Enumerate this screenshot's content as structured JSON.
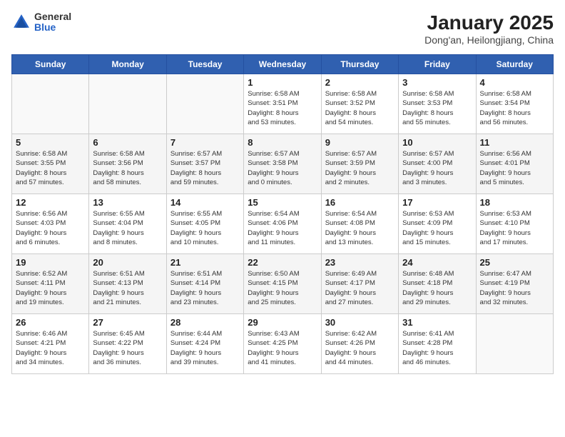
{
  "header": {
    "logo_general": "General",
    "logo_blue": "Blue",
    "title": "January 2025",
    "subtitle": "Dong'an, Heilongjiang, China"
  },
  "days_of_week": [
    "Sunday",
    "Monday",
    "Tuesday",
    "Wednesday",
    "Thursday",
    "Friday",
    "Saturday"
  ],
  "weeks": [
    [
      {
        "day": "",
        "info": ""
      },
      {
        "day": "",
        "info": ""
      },
      {
        "day": "",
        "info": ""
      },
      {
        "day": "1",
        "info": "Sunrise: 6:58 AM\nSunset: 3:51 PM\nDaylight: 8 hours\nand 53 minutes."
      },
      {
        "day": "2",
        "info": "Sunrise: 6:58 AM\nSunset: 3:52 PM\nDaylight: 8 hours\nand 54 minutes."
      },
      {
        "day": "3",
        "info": "Sunrise: 6:58 AM\nSunset: 3:53 PM\nDaylight: 8 hours\nand 55 minutes."
      },
      {
        "day": "4",
        "info": "Sunrise: 6:58 AM\nSunset: 3:54 PM\nDaylight: 8 hours\nand 56 minutes."
      }
    ],
    [
      {
        "day": "5",
        "info": "Sunrise: 6:58 AM\nSunset: 3:55 PM\nDaylight: 8 hours\nand 57 minutes."
      },
      {
        "day": "6",
        "info": "Sunrise: 6:58 AM\nSunset: 3:56 PM\nDaylight: 8 hours\nand 58 minutes."
      },
      {
        "day": "7",
        "info": "Sunrise: 6:57 AM\nSunset: 3:57 PM\nDaylight: 8 hours\nand 59 minutes."
      },
      {
        "day": "8",
        "info": "Sunrise: 6:57 AM\nSunset: 3:58 PM\nDaylight: 9 hours\nand 0 minutes."
      },
      {
        "day": "9",
        "info": "Sunrise: 6:57 AM\nSunset: 3:59 PM\nDaylight: 9 hours\nand 2 minutes."
      },
      {
        "day": "10",
        "info": "Sunrise: 6:57 AM\nSunset: 4:00 PM\nDaylight: 9 hours\nand 3 minutes."
      },
      {
        "day": "11",
        "info": "Sunrise: 6:56 AM\nSunset: 4:01 PM\nDaylight: 9 hours\nand 5 minutes."
      }
    ],
    [
      {
        "day": "12",
        "info": "Sunrise: 6:56 AM\nSunset: 4:03 PM\nDaylight: 9 hours\nand 6 minutes."
      },
      {
        "day": "13",
        "info": "Sunrise: 6:55 AM\nSunset: 4:04 PM\nDaylight: 9 hours\nand 8 minutes."
      },
      {
        "day": "14",
        "info": "Sunrise: 6:55 AM\nSunset: 4:05 PM\nDaylight: 9 hours\nand 10 minutes."
      },
      {
        "day": "15",
        "info": "Sunrise: 6:54 AM\nSunset: 4:06 PM\nDaylight: 9 hours\nand 11 minutes."
      },
      {
        "day": "16",
        "info": "Sunrise: 6:54 AM\nSunset: 4:08 PM\nDaylight: 9 hours\nand 13 minutes."
      },
      {
        "day": "17",
        "info": "Sunrise: 6:53 AM\nSunset: 4:09 PM\nDaylight: 9 hours\nand 15 minutes."
      },
      {
        "day": "18",
        "info": "Sunrise: 6:53 AM\nSunset: 4:10 PM\nDaylight: 9 hours\nand 17 minutes."
      }
    ],
    [
      {
        "day": "19",
        "info": "Sunrise: 6:52 AM\nSunset: 4:11 PM\nDaylight: 9 hours\nand 19 minutes."
      },
      {
        "day": "20",
        "info": "Sunrise: 6:51 AM\nSunset: 4:13 PM\nDaylight: 9 hours\nand 21 minutes."
      },
      {
        "day": "21",
        "info": "Sunrise: 6:51 AM\nSunset: 4:14 PM\nDaylight: 9 hours\nand 23 minutes."
      },
      {
        "day": "22",
        "info": "Sunrise: 6:50 AM\nSunset: 4:15 PM\nDaylight: 9 hours\nand 25 minutes."
      },
      {
        "day": "23",
        "info": "Sunrise: 6:49 AM\nSunset: 4:17 PM\nDaylight: 9 hours\nand 27 minutes."
      },
      {
        "day": "24",
        "info": "Sunrise: 6:48 AM\nSunset: 4:18 PM\nDaylight: 9 hours\nand 29 minutes."
      },
      {
        "day": "25",
        "info": "Sunrise: 6:47 AM\nSunset: 4:19 PM\nDaylight: 9 hours\nand 32 minutes."
      }
    ],
    [
      {
        "day": "26",
        "info": "Sunrise: 6:46 AM\nSunset: 4:21 PM\nDaylight: 9 hours\nand 34 minutes."
      },
      {
        "day": "27",
        "info": "Sunrise: 6:45 AM\nSunset: 4:22 PM\nDaylight: 9 hours\nand 36 minutes."
      },
      {
        "day": "28",
        "info": "Sunrise: 6:44 AM\nSunset: 4:24 PM\nDaylight: 9 hours\nand 39 minutes."
      },
      {
        "day": "29",
        "info": "Sunrise: 6:43 AM\nSunset: 4:25 PM\nDaylight: 9 hours\nand 41 minutes."
      },
      {
        "day": "30",
        "info": "Sunrise: 6:42 AM\nSunset: 4:26 PM\nDaylight: 9 hours\nand 44 minutes."
      },
      {
        "day": "31",
        "info": "Sunrise: 6:41 AM\nSunset: 4:28 PM\nDaylight: 9 hours\nand 46 minutes."
      },
      {
        "day": "",
        "info": ""
      }
    ]
  ]
}
